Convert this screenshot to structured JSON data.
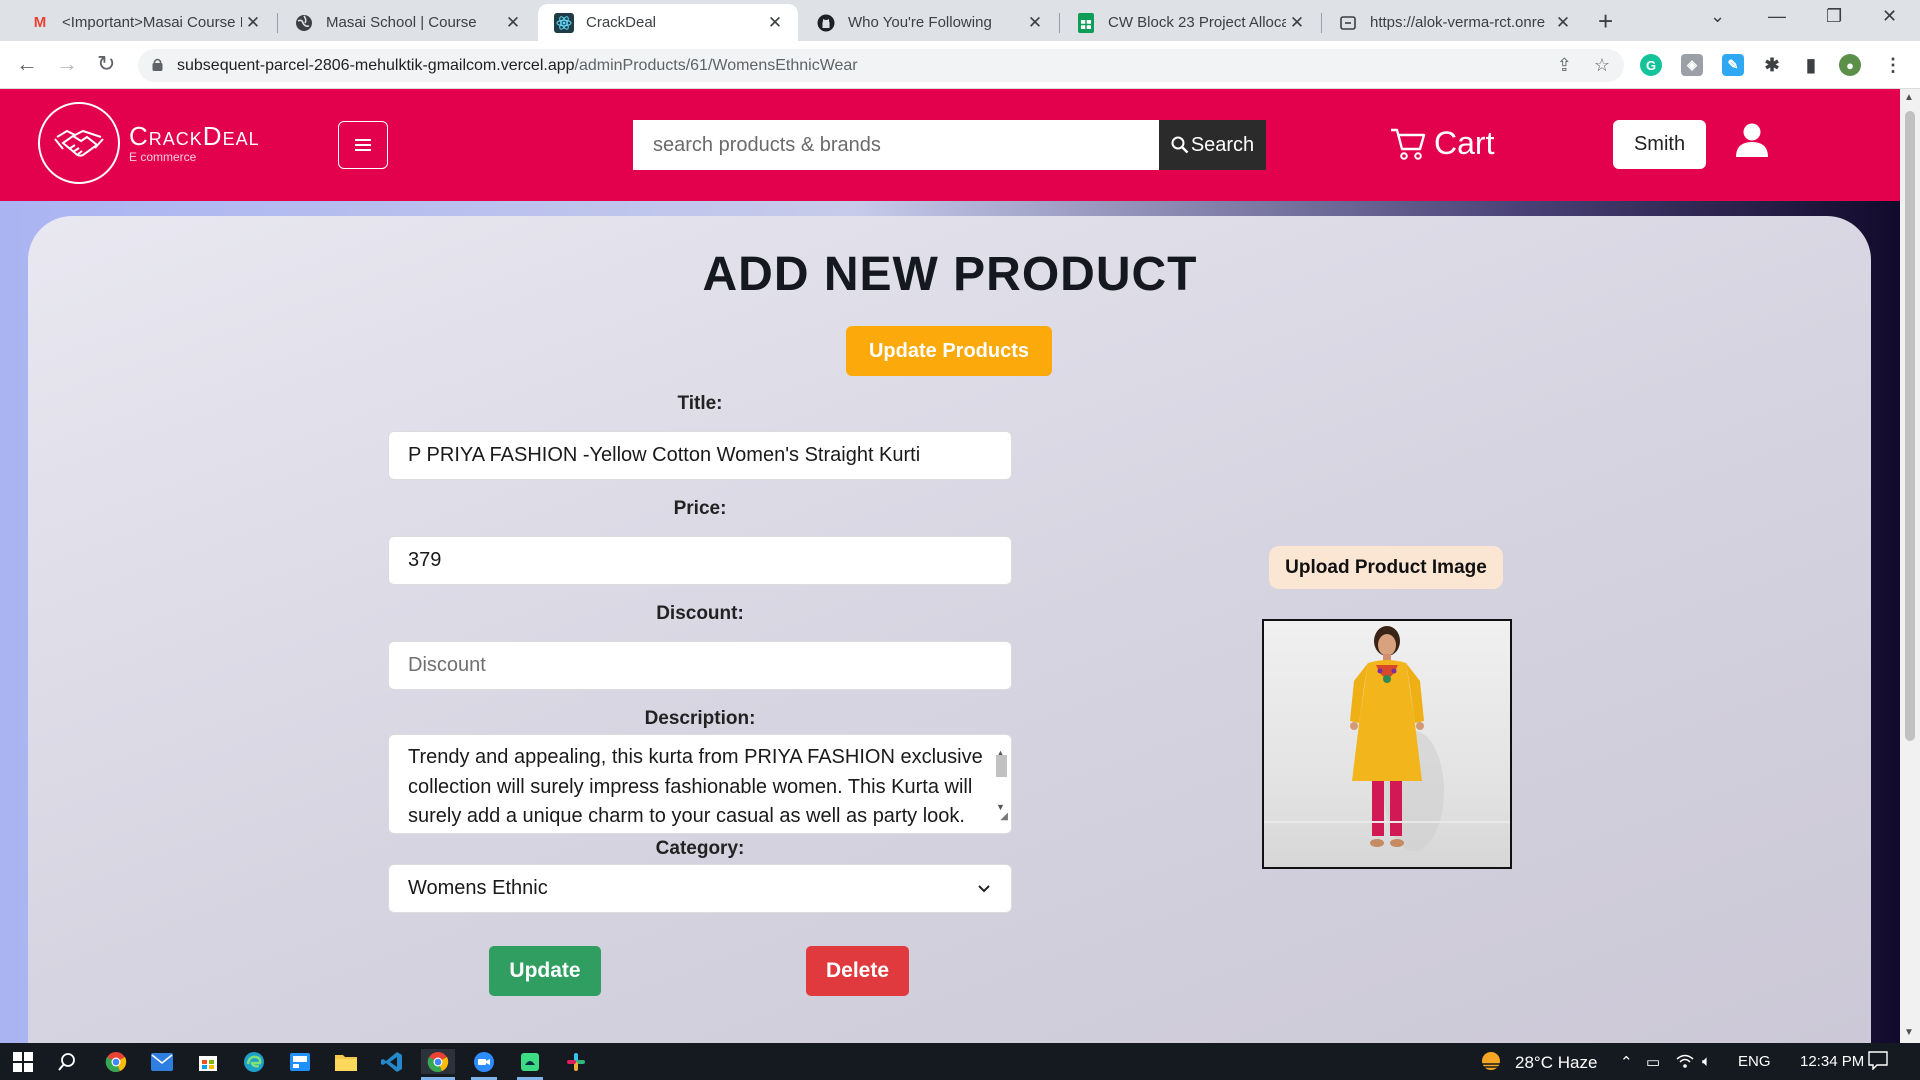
{
  "browser": {
    "tabs": [
      {
        "title": "<Important>Masai Course I",
        "icon": "gmail-icon",
        "icon_color": "#ea4335"
      },
      {
        "title": "Masai School | Course",
        "icon": "globe-icon",
        "icon_color": "#3c4043"
      },
      {
        "title": "CrackDeal",
        "icon": "react-icon",
        "icon_color": "#1f6b73",
        "active": true
      },
      {
        "title": "Who You're Following",
        "icon": "github-icon",
        "icon_color": "#202124"
      },
      {
        "title": "CW Block 23 Project Alloca",
        "icon": "sheets-icon",
        "icon_color": "#0f9d58"
      },
      {
        "title": "https://alok-verma-rct.onre",
        "icon": "page-icon",
        "icon_color": "#3c4043"
      }
    ],
    "url_host": "subsequent-parcel-2806-mehulktik-gmailcom.vercel.app",
    "url_path": "/adminProducts/61/WomensEthnicWear"
  },
  "site": {
    "logo_name": "CrackDeal",
    "logo_tagline": "E commerce",
    "search_placeholder": "search products & brands",
    "search_button": "Search",
    "cart_label": "Cart",
    "user_name": "Smith",
    "brand_color": "#e3004d"
  },
  "form": {
    "heading": "ADD NEW PRODUCT",
    "update_products_button": "Update Products",
    "title_label": "Title:",
    "title_value": "P PRIYA FASHION -Yellow Cotton Women's Straight Kurti",
    "price_label": "Price:",
    "price_value": "379",
    "discount_label": "Discount:",
    "discount_placeholder": "Discount",
    "description_label": "Description:",
    "description_value": "Trendy and appealing, this kurta from PRIYA FASHION exclusive collection will surely impress fashionable women. This Kurta will surely add a unique charm to your casual as well as party look.",
    "category_label": "Category:",
    "category_value": "Womens Ethnic",
    "update_button": "Update",
    "delete_button": "Delete",
    "upload_image_button": "Upload Product Image"
  },
  "taskbar": {
    "weather": "28°C  Haze",
    "language": "ENG",
    "time": "12:34 PM"
  }
}
